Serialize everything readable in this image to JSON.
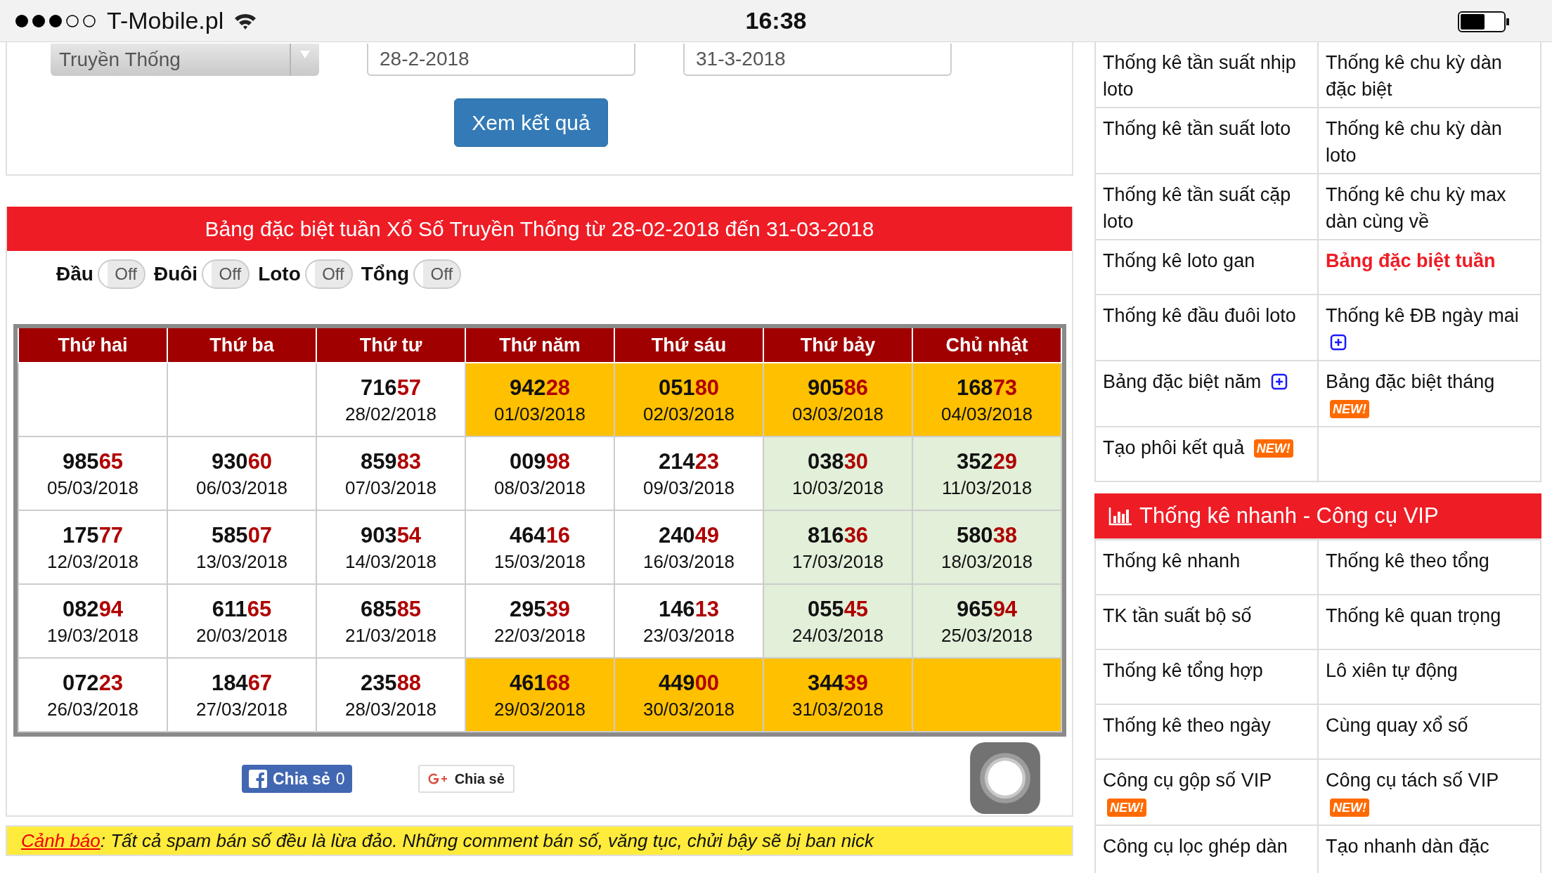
{
  "status_bar": {
    "carrier": "T-Mobile.pl",
    "time": "16:38"
  },
  "form": {
    "lottery": "Truyền Thống",
    "from_date": "28-2-2018",
    "to_date": "31-3-2018",
    "submit": "Xem kết quả"
  },
  "result": {
    "title": "Bảng đặc biệt tuần Xổ Số Truyền Thống từ 28-02-2018 đến 31-03-2018",
    "toggles": [
      {
        "label": "Đầu",
        "state": "Off",
        "on": false
      },
      {
        "label": "Đuôi",
        "state": "Off",
        "on": false
      },
      {
        "label": "Loto",
        "state": "Off",
        "on": false
      },
      {
        "label": "Tổng",
        "state": "Off",
        "on": false
      }
    ],
    "table": {
      "columns": [
        "Thứ hai",
        "Thứ ba",
        "Thứ tư",
        "Thứ năm",
        "Thứ sáu",
        "Thứ bảy",
        "Chủ nhật"
      ],
      "rows": [
        {
          "cells": [
            {
              "color": "#ffffff"
            },
            {
              "color": "#ffffff"
            },
            {
              "number": "71657",
              "date": "28/02/2018",
              "color": "#ffffff"
            },
            {
              "number": "94228",
              "date": "01/03/2018",
              "color": "#ffc000"
            },
            {
              "number": "05180",
              "date": "02/03/2018",
              "color": "#ffc000"
            },
            {
              "number": "90586",
              "date": "03/03/2018",
              "color": "#ffc000"
            },
            {
              "number": "16873",
              "date": "04/03/2018",
              "color": "#ffc000"
            }
          ]
        },
        {
          "cells": [
            {
              "number": "98565",
              "date": "05/03/2018",
              "color": "#ffffff"
            },
            {
              "number": "93060",
              "date": "06/03/2018",
              "color": "#ffffff"
            },
            {
              "number": "85983",
              "date": "07/03/2018",
              "color": "#ffffff"
            },
            {
              "number": "00998",
              "date": "08/03/2018",
              "color": "#ffffff"
            },
            {
              "number": "21423",
              "date": "09/03/2018",
              "color": "#ffffff"
            },
            {
              "number": "03830",
              "date": "10/03/2018",
              "color": "#e2efd9"
            },
            {
              "number": "35229",
              "date": "11/03/2018",
              "color": "#e2efd9"
            }
          ]
        },
        {
          "cells": [
            {
              "number": "17577",
              "date": "12/03/2018",
              "color": "#ffffff"
            },
            {
              "number": "58507",
              "date": "13/03/2018",
              "color": "#ffffff"
            },
            {
              "number": "90354",
              "date": "14/03/2018",
              "color": "#ffffff"
            },
            {
              "number": "46416",
              "date": "15/03/2018",
              "color": "#ffffff"
            },
            {
              "number": "24049",
              "date": "16/03/2018",
              "color": "#ffffff"
            },
            {
              "number": "81636",
              "date": "17/03/2018",
              "color": "#e2efd9"
            },
            {
              "number": "58038",
              "date": "18/03/2018",
              "color": "#e2efd9"
            }
          ]
        },
        {
          "cells": [
            {
              "number": "08294",
              "date": "19/03/2018",
              "color": "#ffffff"
            },
            {
              "number": "61165",
              "date": "20/03/2018",
              "color": "#ffffff"
            },
            {
              "number": "68585",
              "date": "21/03/2018",
              "color": "#ffffff"
            },
            {
              "number": "29539",
              "date": "22/03/2018",
              "color": "#ffffff"
            },
            {
              "number": "14613",
              "date": "23/03/2018",
              "color": "#ffffff"
            },
            {
              "number": "05545",
              "date": "24/03/2018",
              "color": "#e2efd9"
            },
            {
              "number": "96594",
              "date": "25/03/2018",
              "color": "#e2efd9"
            }
          ]
        },
        {
          "cells": [
            {
              "number": "07223",
              "date": "26/03/2018",
              "color": "#ffffff"
            },
            {
              "number": "18467",
              "date": "27/03/2018",
              "color": "#ffffff"
            },
            {
              "number": "23588",
              "date": "28/03/2018",
              "color": "#ffffff"
            },
            {
              "number": "46168",
              "date": "29/03/2018",
              "color": "#ffc000"
            },
            {
              "number": "44900",
              "date": "30/03/2018",
              "color": "#ffc000"
            },
            {
              "number": "34439",
              "date": "31/03/2018",
              "color": "#ffc000"
            },
            {
              "color": "#ffc000"
            }
          ]
        }
      ]
    },
    "share": {
      "facebook": {
        "label": "Chia sẻ",
        "count": "0"
      },
      "google": {
        "label": "Chia sẻ"
      }
    }
  },
  "warning": {
    "label": "Cảnh báo",
    "text": ": Tất cả spam bán số đều là lừa đảo. Những comment bán số, văng tục, chửi bậy sẽ bị ban nick"
  },
  "sidebar": {
    "menu": {
      "items": [
        {
          "label": "Thống kê tần suất nhịp loto",
          "selected": false
        },
        {
          "label": "Thống kê chu kỳ dàn đặc biệt",
          "selected": false
        },
        {
          "label": "Thống kê tần suất loto",
          "selected": false
        },
        {
          "label": "Thống kê chu kỳ dàn loto",
          "selected": false
        },
        {
          "label": "Thống kê tần suất cặp loto",
          "selected": false
        },
        {
          "label": "Thống kê chu kỳ max dàn cùng về",
          "selected": false
        },
        {
          "label": "Thống kê loto gan",
          "selected": false
        },
        {
          "label": "Bảng đặc biệt tuần",
          "selected": true
        },
        {
          "label": "Thống kê đầu đuôi loto",
          "selected": false
        },
        {
          "label": "Thống kê ĐB ngày mai",
          "selected": false,
          "badge": {
            "kind": "plus"
          }
        },
        {
          "label": "Bảng đặc biệt năm",
          "selected": false,
          "badge": {
            "kind": "plus"
          }
        },
        {
          "label": "Bảng đặc biệt tháng",
          "selected": false,
          "badge": {
            "kind": "new",
            "text": "NEW!"
          }
        },
        {
          "label": "Tạo phôi kết quả",
          "selected": false,
          "badge": {
            "kind": "new",
            "text": "NEW!"
          }
        }
      ]
    },
    "vip": {
      "title": "Thống kê nhanh - Công cụ VIP",
      "items": [
        {
          "label": "Thống kê nhanh",
          "selected": false
        },
        {
          "label": "Thống kê theo tổng",
          "selected": false
        },
        {
          "label": "TK tần suất bộ số",
          "selected": false
        },
        {
          "label": "Thống kê quan trọng",
          "selected": false
        },
        {
          "label": "Thống kê tổng hợp",
          "selected": false
        },
        {
          "label": "Lô xiên tự động",
          "selected": false
        },
        {
          "label": "Thống kê theo ngày",
          "selected": false
        },
        {
          "label": "Cùng quay xổ số",
          "selected": false
        },
        {
          "label": "Công cụ gộp số VIP",
          "selected": false,
          "badge": {
            "kind": "new",
            "text": "NEW!"
          }
        },
        {
          "label": "Công cụ tách số VIP",
          "selected": false,
          "badge": {
            "kind": "new",
            "text": "NEW!"
          }
        },
        {
          "label": "Công cụ lọc ghép dàn",
          "selected": false
        },
        {
          "label": "Tạo nhanh dàn đặc",
          "selected": false
        }
      ]
    }
  }
}
